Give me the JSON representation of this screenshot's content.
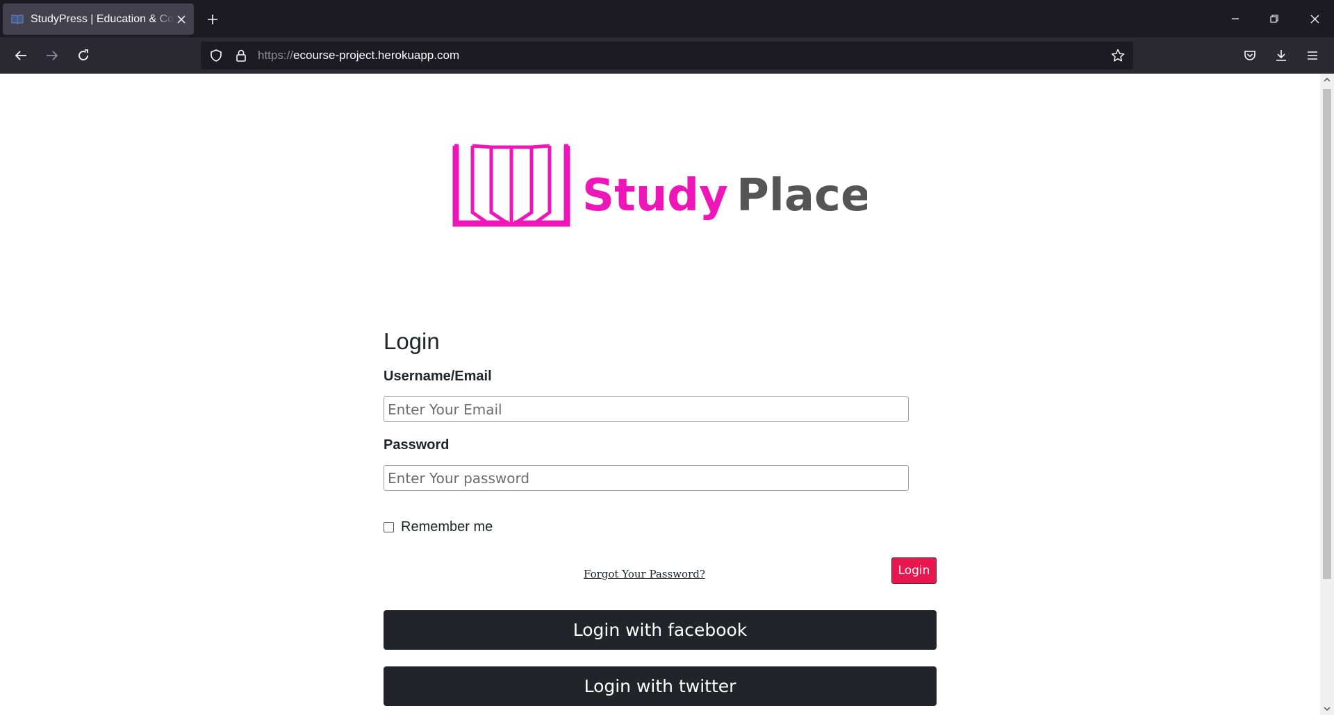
{
  "browser": {
    "tab_title": "StudyPress | Education & Courses",
    "url_scheme": "https://",
    "url_host": "ecourse-project.herokuapp.com"
  },
  "logo": {
    "word1": "Study",
    "word2": "Place",
    "pink": "#ee16b9",
    "gray": "#555555"
  },
  "form": {
    "heading": "Login",
    "username_label": "Username/Email",
    "username_placeholder": "Enter Your Email",
    "password_label": "Password",
    "password_placeholder": "Enter Your password",
    "remember_label": "Remember me",
    "forgot_link": "Forgot Your Password?",
    "login_button": "Login",
    "facebook_button": "Login with facebook",
    "twitter_button": "Login with twitter"
  },
  "colors": {
    "accent": "#e8174f",
    "dark_button": "#212529"
  }
}
